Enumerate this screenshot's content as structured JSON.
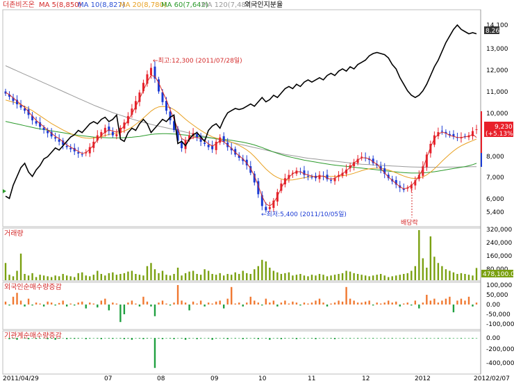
{
  "legend": {
    "name": "더존비즈온",
    "items": [
      {
        "text": "MA 5(8,850)",
        "color": "#d42a2a"
      },
      {
        "text": "MA 10(8,827)",
        "color": "#2a4fd4"
      },
      {
        "text": "MA 20(8,780)",
        "color": "#e8a020"
      },
      {
        "text": "MA 60(7,642)",
        "color": "#2a9a2a"
      },
      {
        "text": "MA 120(7,487)",
        "color": "#9a9a9a"
      },
      {
        "text": "외국인지분율",
        "color": "#000000"
      }
    ]
  },
  "price_panel": {
    "y_ticks": [
      "14,100",
      "13,000",
      "12,000",
      "11,000",
      "10,000",
      "9,000",
      "8,000",
      "7,000",
      "6,000",
      "5,400"
    ],
    "foreign_ratio_badge": "8.26",
    "current_price_badge": "9,230",
    "current_change_badge": "(+5.13%)",
    "annotation_high": "←최고:12,300 (2011/07/28일)",
    "annotation_low": "←최저:5,400 (2011/10/05일)",
    "annotation_dividend": "배당락"
  },
  "volume_panel": {
    "title": "거래량",
    "y_ticks": [
      "320,000",
      "240,000",
      "160,000",
      "80,000"
    ],
    "current_badge": "478,100.0"
  },
  "foreign_panel": {
    "title": "외국인순매수량증감",
    "y_ticks": [
      "100,000",
      "50,000",
      "0.00",
      "-50,000",
      "-100,000"
    ]
  },
  "inst_panel": {
    "title": "기관계순매수량증감",
    "y_ticks": [
      "0.00",
      "-200,000",
      "-400,000"
    ]
  },
  "x_axis": {
    "labels": [
      "2011/04/29",
      "07",
      "08",
      "09",
      "10",
      "11",
      "12",
      "2012",
      "2012/02/07"
    ]
  },
  "colors": {
    "up": "#e8202a",
    "down": "#1a3ad4",
    "ma5": "#d42a2a",
    "ma10": "#2a4fd4",
    "ma20": "#e8a020",
    "ma60": "#2a9a2a",
    "ma120": "#9a9a9a",
    "foreign": "#000000",
    "volume": "#7aa010",
    "buy": "#f07830",
    "sell": "#20a040"
  },
  "chart_data": [
    {
      "type": "candlestick",
      "title": "더존비즈온",
      "ylim": [
        5000,
        14300
      ],
      "closes": [
        10900,
        10750,
        10550,
        10400,
        10250,
        10100,
        9900,
        9650,
        9500,
        9350,
        9200,
        9050,
        8900,
        8800,
        8650,
        8500,
        8400,
        8300,
        8200,
        8100,
        8050,
        8150,
        8400,
        8650,
        8950,
        9100,
        9300,
        9150,
        8950,
        9000,
        9300,
        9550,
        9850,
        10200,
        10550,
        10950,
        11400,
        11800,
        12100,
        11600,
        11000,
        10500,
        10100,
        9650,
        9200,
        8700,
        8350,
        8700,
        8950,
        9050,
        8850,
        8650,
        8550,
        8400,
        8300,
        8650,
        8850,
        8650,
        8400,
        8250,
        8050,
        7900,
        7750,
        7550,
        7200,
        6750,
        6200,
        5650,
        5450,
        5600,
        5900,
        6300,
        6700,
        6950,
        7100,
        7200,
        7300,
        7250,
        7100,
        7050,
        7000,
        6950,
        7100,
        7050,
        6900,
        6850,
        6950,
        7100,
        7200,
        7350,
        7550,
        7700,
        7850,
        7950,
        7900,
        7800,
        7650,
        7550,
        7350,
        7150,
        6950,
        6800,
        6650,
        6500,
        6400,
        6500,
        6650,
        6850,
        7100,
        7500,
        8050,
        8550,
        8950,
        9100,
        9150,
        9050,
        8950,
        8900,
        8850,
        8850,
        8900,
        8950,
        9150,
        9230
      ],
      "ma5": [
        10950,
        10850,
        10700,
        10550,
        10400,
        10250,
        10050,
        9850,
        9650,
        9500,
        9350,
        9200,
        9050,
        8900,
        8800,
        8650,
        8500,
        8400,
        8300,
        8200,
        8100,
        8150,
        8300,
        8500,
        8750,
        8950,
        9100,
        9200,
        9150,
        9100,
        9200,
        9400,
        9650,
        9950,
        10300,
        10650,
        11050,
        11450,
        11750,
        11700,
        11400,
        11000,
        10600,
        10150,
        9700,
        9250,
        8800,
        8700,
        8750,
        8850,
        8850,
        8800,
        8700,
        8550,
        8450,
        8550,
        8700,
        8650,
        8500,
        8350,
        8150,
        8000,
        7850,
        7650,
        7400,
        7050,
        6600,
        6100,
        5750,
        5650,
        5800,
        6100,
        6500,
        6800,
        7000,
        7150,
        7250,
        7250,
        7150,
        7100,
        7050,
        7000,
        7050,
        7050,
        6950,
        6900,
        6950,
        7050,
        7150,
        7300,
        7450,
        7650,
        7800,
        7900,
        7900,
        7850,
        7700,
        7600,
        7400,
        7200,
        7000,
        6850,
        6700,
        6550,
        6450,
        6500,
        6600,
        6800,
        7050,
        7400,
        7900,
        8400,
        8800,
        9000,
        9100,
        9050,
        8950,
        8900,
        8850,
        8850,
        8880,
        8900,
        9000,
        8850
      ],
      "ma20": [
        10600,
        10550,
        10500,
        10450,
        10380,
        10300,
        10200,
        10100,
        9980,
        9860,
        9740,
        9620,
        9500,
        9400,
        9300,
        9200,
        9110,
        9030,
        8960,
        8900,
        8850,
        8820,
        8810,
        8820,
        8850,
        8890,
        8940,
        8990,
        9020,
        9050,
        9090,
        9150,
        9230,
        9330,
        9460,
        9600,
        9760,
        9920,
        10080,
        10200,
        10280,
        10300,
        10290,
        10240,
        10150,
        10020,
        9860,
        9700,
        9560,
        9430,
        9300,
        9180,
        9070,
        8970,
        8880,
        8820,
        8780,
        8740,
        8690,
        8630,
        8560,
        8480,
        8380,
        8270,
        8130,
        7960,
        7770,
        7570,
        7380,
        7220,
        7080,
        6980,
        6910,
        6870,
        6860,
        6870,
        6900,
        6940,
        6970,
        7000,
        7020,
        7030,
        7040,
        7040,
        7040,
        7030,
        7030,
        7040,
        7060,
        7090,
        7130,
        7180,
        7240,
        7300,
        7350,
        7390,
        7410,
        7420,
        7410,
        7380,
        7330,
        7270,
        7200,
        7120,
        7050,
        6990,
        6950,
        6940,
        6960,
        7010,
        7100,
        7230,
        7390,
        7560,
        7740,
        7910,
        8070,
        8220,
        8350,
        8460,
        8550,
        8630,
        8700,
        8780
      ],
      "ma60": [
        9600,
        9560,
        9520,
        9480,
        9440,
        9400,
        9360,
        9320,
        9280,
        9250,
        9220,
        9190,
        9160,
        9130,
        9100,
        9070,
        9040,
        9010,
        8980,
        8950,
        8930,
        8910,
        8890,
        8870,
        8860,
        8850,
        8840,
        8830,
        8830,
        8830,
        8830,
        8840,
        8850,
        8860,
        8880,
        8900,
        8930,
        8960,
        8990,
        9010,
        9020,
        9030,
        9030,
        9020,
        9010,
        9000,
        8980,
        8960,
        8940,
        8920,
        8900,
        8880,
        8860,
        8840,
        8820,
        8800,
        8780,
        8760,
        8740,
        8720,
        8690,
        8660,
        8630,
        8590,
        8550,
        8500,
        8440,
        8380,
        8310,
        8240,
        8170,
        8110,
        8050,
        8000,
        7950,
        7910,
        7870,
        7830,
        7790,
        7760,
        7730,
        7700,
        7670,
        7640,
        7610,
        7580,
        7560,
        7540,
        7520,
        7500,
        7480,
        7460,
        7440,
        7420,
        7400,
        7380,
        7360,
        7340,
        7320,
        7300,
        7280,
        7260,
        7240,
        7220,
        7210,
        7200,
        7190,
        7190,
        7190,
        7200,
        7210,
        7230,
        7250,
        7280,
        7310,
        7340,
        7370,
        7400,
        7430,
        7460,
        7490,
        7530,
        7580,
        7642
      ],
      "ma120": [
        12200,
        12120,
        12040,
        11960,
        11880,
        11800,
        11720,
        11640,
        11560,
        11480,
        11400,
        11320,
        11240,
        11160,
        11080,
        11000,
        10920,
        10840,
        10760,
        10680,
        10600,
        10520,
        10440,
        10360,
        10290,
        10220,
        10150,
        10080,
        10010,
        9950,
        9890,
        9830,
        9770,
        9710,
        9660,
        9610,
        9560,
        9510,
        9460,
        9420,
        9380,
        9340,
        9300,
        9260,
        9220,
        9180,
        9140,
        9100,
        9060,
        9020,
        8980,
        8940,
        8900,
        8860,
        8820,
        8780,
        8740,
        8700,
        8660,
        8620,
        8580,
        8540,
        8500,
        8460,
        8420,
        8380,
        8340,
        8300,
        8260,
        8220,
        8180,
        8140,
        8100,
        8060,
        8030,
        8000,
        7970,
        7940,
        7910,
        7880,
        7860,
        7840,
        7820,
        7800,
        7780,
        7760,
        7740,
        7720,
        7700,
        7680,
        7660,
        7640,
        7620,
        7600,
        7590,
        7580,
        7570,
        7560,
        7550,
        7540,
        7530,
        7520,
        7510,
        7500,
        7490,
        7480,
        7475,
        7470,
        7465,
        7460,
        7460,
        7460,
        7460,
        7462,
        7464,
        7466,
        7468,
        7470,
        7472,
        7475,
        7478,
        7481,
        7484,
        7487
      ],
      "foreign_ratio": [
        6.3,
        6.2,
        6.8,
        7.2,
        7.6,
        7.8,
        7.4,
        7.2,
        7.5,
        7.7,
        8.0,
        8.1,
        8.3,
        8.5,
        8.4,
        8.6,
        8.8,
        9.0,
        9.1,
        9.3,
        9.2,
        9.4,
        9.6,
        9.7,
        9.6,
        9.8,
        9.9,
        9.7,
        9.8,
        10.0,
        8.9,
        8.8,
        9.2,
        9.4,
        9.3,
        9.6,
        9.8,
        9.6,
        9.2,
        9.4,
        9.6,
        9.8,
        9.7,
        9.9,
        10.0,
        8.7,
        8.8,
        8.6,
        8.9,
        9.1,
        9.2,
        9.0,
        8.8,
        9.3,
        9.5,
        9.6,
        9.4,
        9.8,
        10.1,
        10.2,
        10.3,
        10.25,
        10.3,
        10.4,
        10.5,
        10.4,
        10.6,
        10.8,
        10.6,
        10.7,
        10.9,
        10.8,
        11.0,
        11.2,
        11.3,
        11.2,
        11.4,
        11.3,
        11.5,
        11.6,
        11.5,
        11.6,
        11.7,
        11.6,
        11.8,
        11.9,
        11.8,
        12.0,
        12.1,
        12.0,
        12.2,
        12.1,
        12.3,
        12.4,
        12.5,
        12.7,
        12.8,
        12.85,
        12.8,
        12.75,
        12.6,
        12.3,
        12.1,
        11.7,
        11.4,
        11.1,
        10.9,
        10.8,
        10.9,
        11.1,
        11.4,
        11.8,
        12.2,
        12.5,
        12.9,
        13.3,
        13.6,
        13.9,
        14.1,
        13.9,
        13.8,
        13.7,
        13.75,
        13.7
      ]
    },
    {
      "type": "bar",
      "title": "거래량",
      "ylim": [
        0,
        340000
      ],
      "values": [
        110000,
        35000,
        25000,
        60000,
        170000,
        40000,
        30000,
        45000,
        20000,
        35000,
        30000,
        25000,
        20000,
        30000,
        25000,
        40000,
        30000,
        25000,
        20000,
        45000,
        50000,
        30000,
        25000,
        35000,
        60000,
        40000,
        30000,
        45000,
        50000,
        35000,
        40000,
        45000,
        55000,
        60000,
        40000,
        35000,
        30000,
        90000,
        110000,
        70000,
        45000,
        60000,
        35000,
        30000,
        40000,
        80000,
        30000,
        45000,
        55000,
        60000,
        40000,
        35000,
        70000,
        60000,
        40000,
        35000,
        45000,
        30000,
        40000,
        35000,
        50000,
        40000,
        60000,
        45000,
        40000,
        70000,
        90000,
        130000,
        120000,
        80000,
        60000,
        50000,
        40000,
        45000,
        50000,
        30000,
        35000,
        40000,
        30000,
        25000,
        35000,
        30000,
        40000,
        35000,
        25000,
        30000,
        35000,
        40000,
        45000,
        60000,
        55000,
        45000,
        40000,
        35000,
        30000,
        25000,
        30000,
        35000,
        40000,
        30000,
        20000,
        25000,
        30000,
        35000,
        40000,
        45000,
        60000,
        90000,
        320000,
        140000,
        80000,
        280000,
        150000,
        110000,
        90000,
        70000,
        60000,
        50000,
        40000,
        45000,
        40000,
        35000,
        30000,
        78100
      ]
    },
    {
      "type": "bar",
      "title": "외국인순매수량증감",
      "ylim": [
        -110000,
        110000
      ],
      "values": [
        15000,
        -5000,
        40000,
        60000,
        20000,
        -10000,
        30000,
        -5000,
        10000,
        5000,
        -10000,
        15000,
        10000,
        -5000,
        8000,
        20000,
        -10000,
        5000,
        -5000,
        10000,
        15000,
        -20000,
        10000,
        5000,
        -15000,
        20000,
        30000,
        -30000,
        10000,
        5000,
        -90000,
        -50000,
        10000,
        20000,
        5000,
        -10000,
        40000,
        15000,
        -10000,
        -60000,
        10000,
        20000,
        5000,
        -5000,
        10000,
        100000,
        20000,
        10000,
        -30000,
        15000,
        5000,
        20000,
        -10000,
        10000,
        5000,
        15000,
        20000,
        -20000,
        30000,
        90000,
        5000,
        10000,
        -10000,
        10000,
        40000,
        20000,
        10000,
        -5000,
        30000,
        10000,
        20000,
        -10000,
        10000,
        20000,
        5000,
        15000,
        10000,
        -5000,
        10000,
        5000,
        10000,
        20000,
        30000,
        10000,
        -10000,
        5000,
        10000,
        20000,
        15000,
        90000,
        30000,
        20000,
        10000,
        10000,
        15000,
        20000,
        -5000,
        10000,
        5000,
        10000,
        20000,
        10000,
        15000,
        -10000,
        5000,
        10000,
        -5000,
        20000,
        -20000,
        10000,
        50000,
        20000,
        30000,
        10000,
        20000,
        30000,
        40000,
        -40000,
        20000,
        30000,
        20000,
        40000,
        -10000,
        10000
      ]
    },
    {
      "type": "bar",
      "title": "기관계순매수량증감",
      "ylim": [
        -500000,
        50000
      ],
      "values": [
        0,
        -20000,
        -10000,
        -30000,
        0,
        -10000,
        -20000,
        -5000,
        -15000,
        -10000,
        -5000,
        -20000,
        -10000,
        -30000,
        -10000,
        -5000,
        -20000,
        -10000,
        -15000,
        -10000,
        -5000,
        -20000,
        -10000,
        -5000,
        -10000,
        -20000,
        -5000,
        -10000,
        -15000,
        -5000,
        -10000,
        -20000,
        -10000,
        -30000,
        -5000,
        -10000,
        -20000,
        -10000,
        -5000,
        -480000,
        -10000,
        -20000,
        -5000,
        -10000,
        -20000,
        -5000,
        -10000,
        -30000,
        -10000,
        -5000,
        -20000,
        -10000,
        -5000,
        -10000,
        -30000,
        -10000,
        -5000,
        -10000,
        -20000,
        -5000,
        -10000,
        -5000,
        -20000,
        -10000,
        -5000,
        -10000,
        -20000,
        -5000,
        -10000,
        -30000,
        -5000,
        -10000,
        -20000,
        -10000,
        -5000,
        -10000,
        -20000,
        -5000,
        -10000,
        -5000,
        -10000,
        -20000,
        -5000,
        -10000,
        -5000,
        -10000,
        -20000,
        -5000,
        -10000,
        -5000,
        -10000,
        -5000,
        -10000,
        -5000,
        -10000,
        -5000,
        -10000,
        -5000,
        -5000,
        -10000,
        -5000,
        -10000,
        -5000,
        -5000,
        -10000,
        -5000,
        -5000,
        -10000,
        -5000,
        -5000,
        -10000,
        -5000,
        -5000,
        -10000,
        -5000,
        -5000,
        -10000,
        -5000,
        -5000,
        -10000,
        -5000,
        -5000,
        -10000,
        -5000
      ]
    }
  ]
}
